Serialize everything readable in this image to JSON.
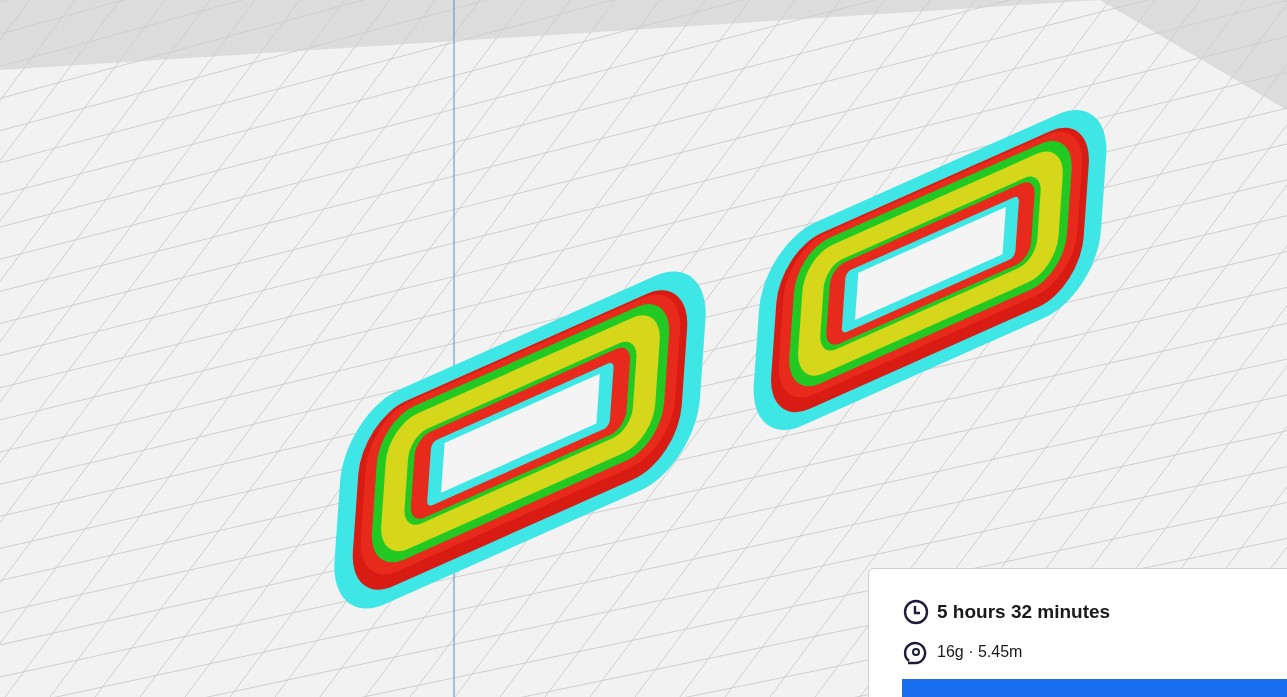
{
  "print_estimate": {
    "time": "5 hours 32 minutes",
    "material": "16g · 5.45m"
  }
}
